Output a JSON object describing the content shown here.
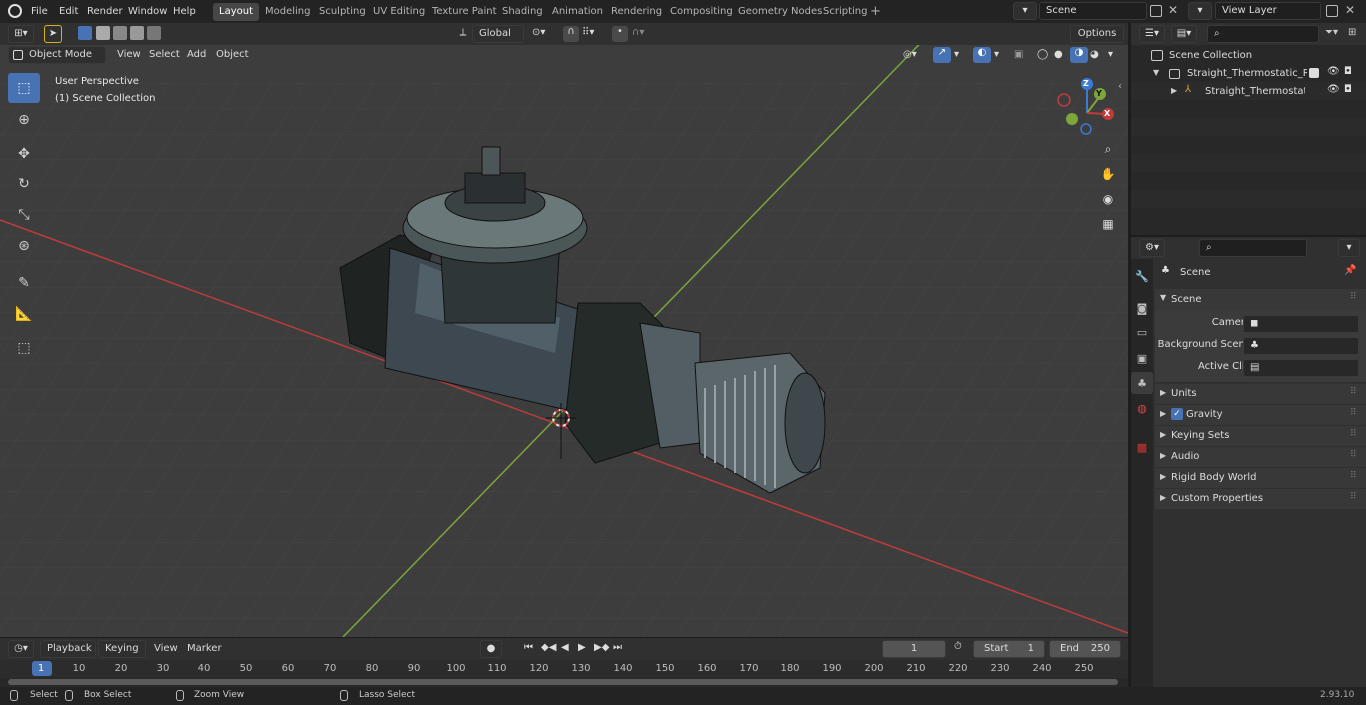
{
  "menus": [
    "File",
    "Edit",
    "Render",
    "Window",
    "Help"
  ],
  "workspaces": [
    "Layout",
    "Modeling",
    "Sculpting",
    "UV Editing",
    "Texture Paint",
    "Shading",
    "Animation",
    "Rendering",
    "Compositing",
    "Geometry Nodes",
    "Scripting"
  ],
  "scene_field": "Scene",
  "view_layer_field": "View Layer",
  "viewport": {
    "mode": "Object Mode",
    "menus": [
      "View",
      "Select",
      "Add",
      "Object"
    ],
    "transform_orientation": "Global",
    "options": "Options",
    "overlay_title": "User Perspective",
    "overlay_collection": "(1) Scene Collection",
    "gizmo_axes": {
      "x": "X",
      "y": "Y",
      "z": "Z"
    }
  },
  "outliner": {
    "root": "Scene Collection",
    "items": [
      "Straight_Thermostatic_Radiat",
      "Straight_Thermostatic_Ra"
    ]
  },
  "properties": {
    "header": "Scene",
    "panel": "Scene",
    "fields": [
      {
        "label": "Camera"
      },
      {
        "label": "Background Scene"
      },
      {
        "label": "Active Clip"
      }
    ],
    "sections": [
      "Units",
      "Gravity",
      "Keying Sets",
      "Audio",
      "Rigid Body World",
      "Custom Properties"
    ],
    "gravity_checked": true
  },
  "timeline": {
    "menus": [
      "Playback",
      "Keying",
      "View",
      "Marker"
    ],
    "current_frame": "1",
    "start_label": "Start",
    "start": "1",
    "end_label": "End",
    "end": "250",
    "ticks": [
      "1",
      "10",
      "20",
      "30",
      "40",
      "50",
      "60",
      "70",
      "80",
      "90",
      "100",
      "110",
      "120",
      "130",
      "140",
      "150",
      "160",
      "170",
      "180",
      "190",
      "200",
      "210",
      "220",
      "230",
      "240",
      "250"
    ]
  },
  "statusbar": {
    "select": "Select",
    "box_select": "Box Select",
    "zoom_view": "Zoom View",
    "lasso_select": "Lasso Select",
    "version": "2.93.10"
  },
  "colors": {
    "accent": "#4772b3",
    "x_axis": "#c23b3b",
    "y_axis": "#7ca63a",
    "z_axis": "#3a7bd5"
  }
}
